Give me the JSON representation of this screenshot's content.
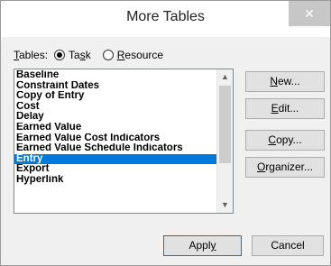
{
  "dialog": {
    "title": "More Tables",
    "close_glyph": "✕"
  },
  "tables_selector": {
    "label_prefix": "",
    "label_underlined": "T",
    "label_rest": "ables:",
    "task_option": {
      "underlined": "",
      "before": "Ta",
      "u": "s",
      "after": "k",
      "checked": true
    },
    "resource_option": {
      "before": "",
      "u": "R",
      "after": "esource",
      "checked": false
    }
  },
  "table_list": {
    "items": [
      "Baseline",
      "Constraint Dates",
      "Copy of Entry",
      "Cost",
      "Delay",
      "Earned Value",
      "Earned Value Cost Indicators",
      "Earned Value Schedule Indicators",
      "Entry",
      "Export",
      "Hyperlink"
    ],
    "selected_index": 8,
    "scroll_up_glyph": "▲",
    "scroll_down_glyph": "▼"
  },
  "buttons": {
    "new": {
      "u": "N",
      "rest": "ew..."
    },
    "edit": {
      "u": "E",
      "rest": "dit..."
    },
    "copy": {
      "u": "C",
      "rest": "opy..."
    },
    "organizer": {
      "u": "O",
      "rest": "rganizer..."
    },
    "apply": {
      "before": "Appl",
      "u": "y",
      "after": ""
    },
    "cancel": "Cancel"
  },
  "colors": {
    "selection": "#0078d7",
    "default_button_border": "#0078d7"
  }
}
